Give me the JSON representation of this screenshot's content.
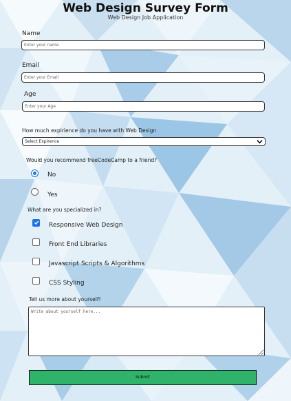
{
  "title": "Web Design Survey Form",
  "subtitle": "Web Design Job Application",
  "fields": {
    "name_label": "Name",
    "name_placeholder": "Enter your name",
    "email_label": "Email",
    "email_placeholder": "Enter your Email",
    "age_label": "Age",
    "age_placeholder": "Enter your Age"
  },
  "experience": {
    "label": "How much expirience do you have with Web Design",
    "selected": "Select Expirence"
  },
  "recommend": {
    "question": "Would you recommend freeCodeCamp to a friend?",
    "options": [
      {
        "label": "No",
        "checked": true
      },
      {
        "label": "Yes",
        "checked": false
      }
    ]
  },
  "specialized": {
    "question": "What are you specialized in?",
    "options": [
      {
        "label": "Responsive Web Design",
        "checked": true
      },
      {
        "label": "Front End Libraries",
        "checked": false
      },
      {
        "label": "Javascript Scripts & Algorithms",
        "checked": false
      },
      {
        "label": "CSS Styling",
        "checked": false
      }
    ]
  },
  "about": {
    "label": "Tell us more about yourself!",
    "placeholder": "Write about yourself here..."
  },
  "submit_label": "Submit",
  "colors": {
    "submit_bg": "#2fb26a",
    "accent": "#1a73e8"
  }
}
